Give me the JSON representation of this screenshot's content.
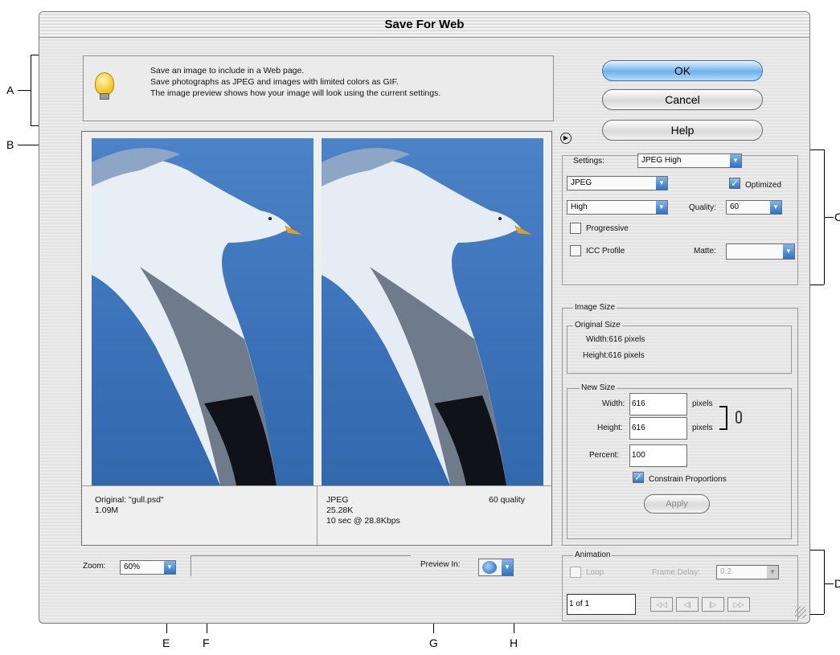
{
  "window": {
    "title": "Save For Web"
  },
  "callouts": {
    "A": "A",
    "B": "B",
    "C": "C",
    "D": "D",
    "E": "E",
    "F": "F",
    "G": "G",
    "H": "H"
  },
  "tools": [
    {
      "name": "hand-icon",
      "glyph": "✋"
    },
    {
      "name": "zoom-icon",
      "glyph": "🔍"
    },
    {
      "name": "eyedropper-icon",
      "glyph": "✒"
    }
  ],
  "info": {
    "line1": "Save an image to include in a Web page.",
    "line2": "Save photographs as JPEG and images with limited colors as GIF.",
    "line3": "The image preview shows how your image will look using the current settings."
  },
  "original": {
    "label": "Original: \"gull.psd\"",
    "size": "1.09M"
  },
  "optimized": {
    "format": "JPEG",
    "size": "25.28K",
    "time": "10 sec @ 28.8Kbps",
    "quality": "60 quality"
  },
  "buttons": {
    "ok": "OK",
    "cancel": "Cancel",
    "help": "Help"
  },
  "settings": {
    "label": "Settings:",
    "preset": "JPEG High",
    "format": "JPEG",
    "quality_level": "High",
    "optimized": "Optimized",
    "quality_label": "Quality:",
    "quality_value": "60",
    "progressive": "Progressive",
    "icc": "ICC Profile",
    "matte": "Matte:"
  },
  "image_size": {
    "title": "Image Size",
    "original_title": "Original Size",
    "orig_width": "Width:616 pixels",
    "orig_height": "Height:616 pixels",
    "new_title": "New Size",
    "width_label": "Width:",
    "width": "616",
    "height_label": "Height:",
    "height": "616",
    "pixels": "pixels",
    "percent_label": "Percent:",
    "percent": "100",
    "constrain": "Constrain Proportions",
    "apply": "Apply"
  },
  "animation": {
    "title": "Animation",
    "loop": "Loop",
    "frame_delay": "Frame Delay:",
    "delay_value": "0.2",
    "frame_count": "1 of 1",
    "nav": [
      "◁◁",
      "◁|",
      "|▷",
      "▷▷"
    ]
  },
  "zoom": {
    "label": "Zoom:",
    "value": "60%"
  },
  "preview_in": {
    "label": "Preview In:"
  },
  "colors": {
    "accent": "#3a78c8",
    "sky": "#3a71b8"
  }
}
